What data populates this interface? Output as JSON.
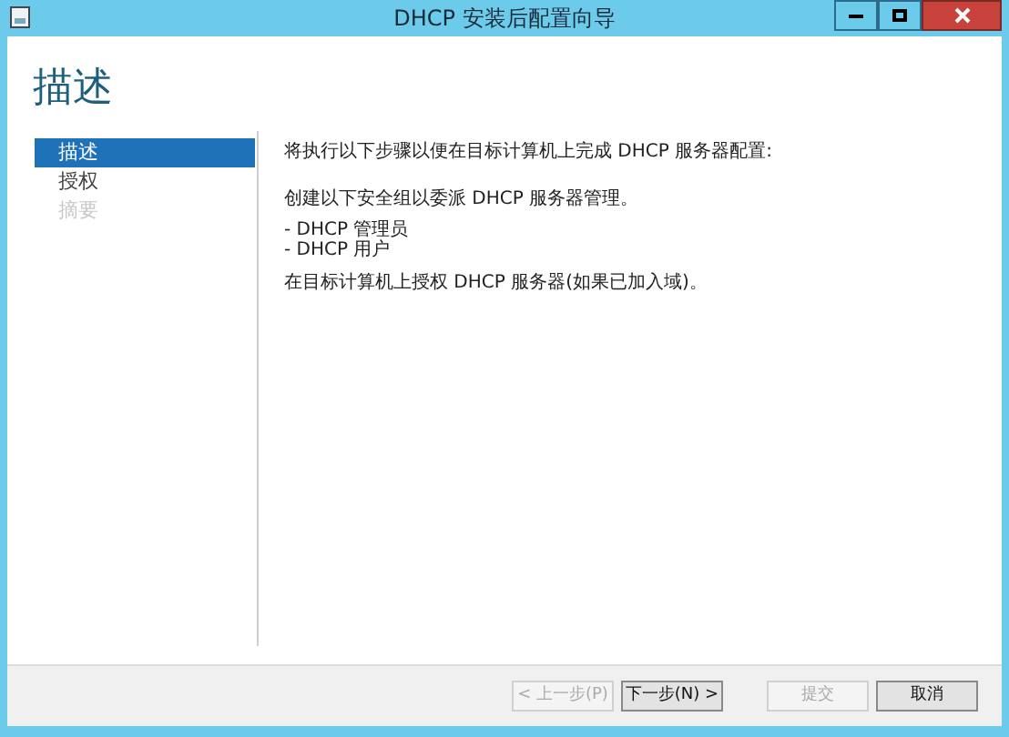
{
  "window": {
    "title": "DHCP 安装后配置向导"
  },
  "page_title": "描述",
  "steps": [
    {
      "label": "描述",
      "selected": true,
      "disabled": false
    },
    {
      "label": "授权",
      "selected": false,
      "disabled": false
    },
    {
      "label": "摘要",
      "selected": false,
      "disabled": true
    }
  ],
  "content": {
    "intro": "将执行以下步骤以便在目标计算机上完成 DHCP 服务器配置:",
    "groups_intro": "创建以下安全组以委派 DHCP 服务器管理。",
    "groups": [
      "- DHCP 管理员",
      "- DHCP 用户"
    ],
    "authorize": "在目标计算机上授权 DHCP 服务器(如果已加入域)。"
  },
  "buttons": [
    {
      "label": "< 上一步(P)",
      "disabled": true
    },
    {
      "label": "下一步(N) >",
      "disabled": false
    },
    {
      "label": "提交",
      "disabled": true
    },
    {
      "label": "取消",
      "disabled": false
    }
  ]
}
